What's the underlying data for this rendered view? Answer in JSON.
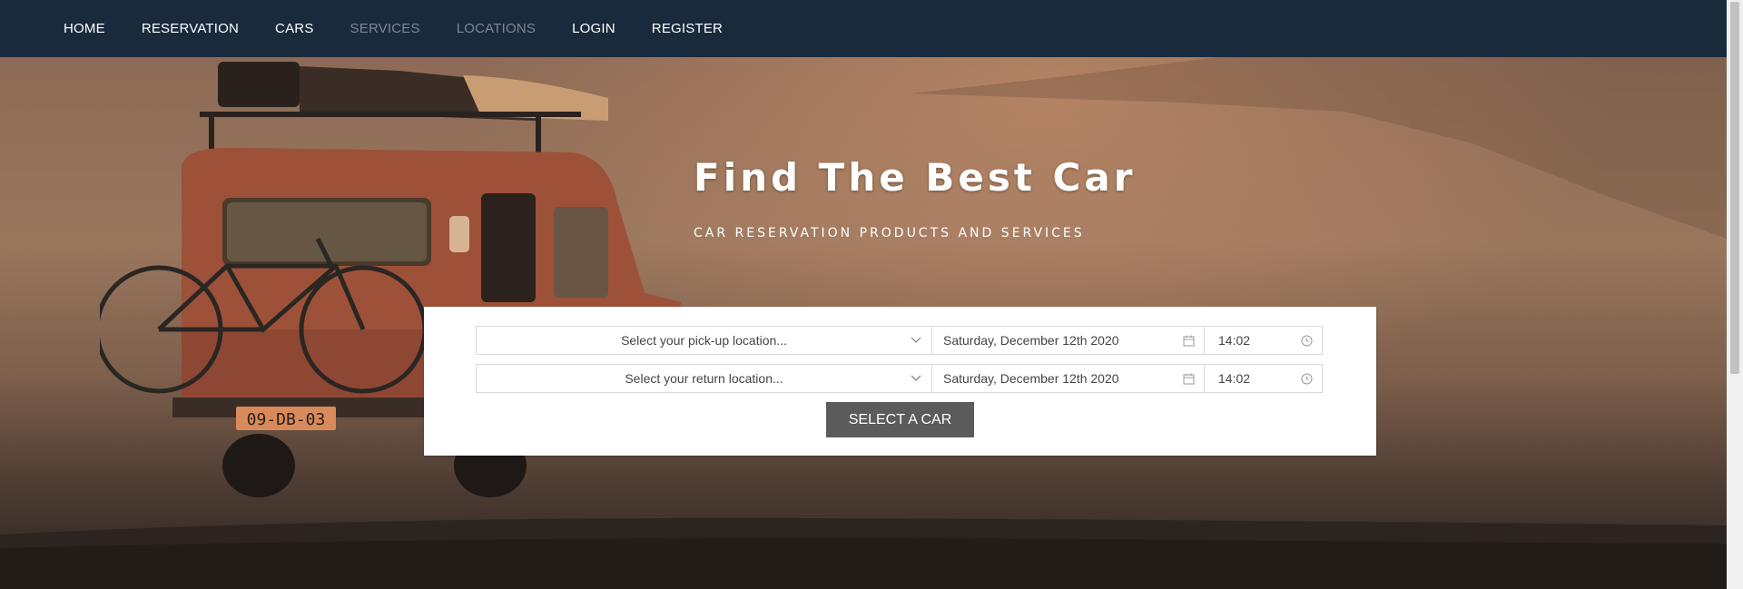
{
  "nav": {
    "items": [
      {
        "label": "HOME"
      },
      {
        "label": "RESERVATION"
      },
      {
        "label": "CARS"
      },
      {
        "label": "SERVICES"
      },
      {
        "label": "LOCATIONS"
      },
      {
        "label": "LOGIN"
      },
      {
        "label": "REGISTER"
      }
    ]
  },
  "hero": {
    "title": "Find The Best Car",
    "subtitle": "CAR RESERVATION PRODUCTS AND SERVICES",
    "license_plate": "09-DB-03"
  },
  "form": {
    "pickup_location": "Select your pick-up location...",
    "pickup_date": "Saturday, December 12th 2020",
    "pickup_time": "14:02",
    "return_location": "Select your return location...",
    "return_date": "Saturday, December 12th 2020",
    "return_time": "14:02",
    "submit_label": "SELECT A CAR"
  },
  "colors": {
    "navbar": "#1a2a3d",
    "button": "#5b5b5b",
    "nav_dim": "#7d8793"
  },
  "icons": {
    "location_dropdown": "chevron-down-icon",
    "date": "calendar-icon",
    "time": "clock-icon"
  }
}
